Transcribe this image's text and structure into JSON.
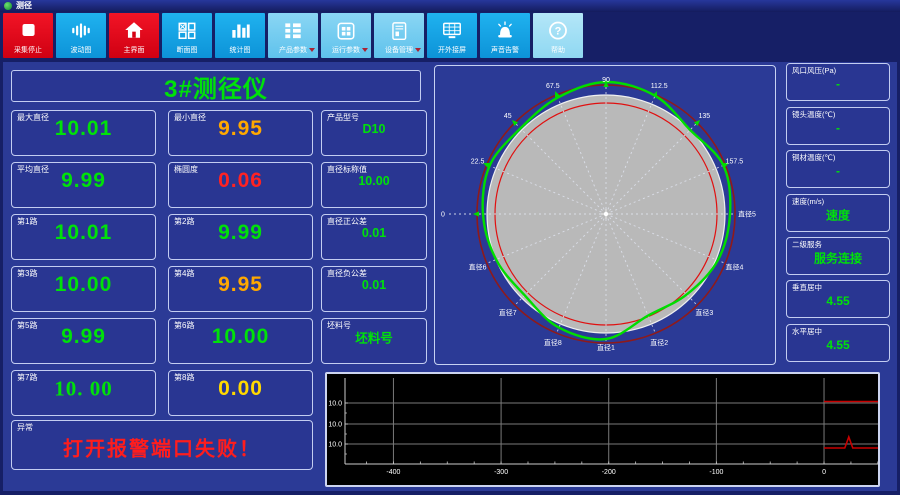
{
  "window": {
    "title": "测径"
  },
  "toolbar": {
    "buttons": [
      {
        "name": "collect-stop",
        "label": "采集停止",
        "icon": "stop-icon",
        "style": "red"
      },
      {
        "name": "wave-chart",
        "label": "波动图",
        "icon": "waveform-icon",
        "style": "blue"
      },
      {
        "name": "main-screen",
        "label": "主界面",
        "icon": "home-icon",
        "style": "red"
      },
      {
        "name": "section-chart",
        "label": "断面图",
        "icon": "sections-icon",
        "style": "blue"
      },
      {
        "name": "stats-chart",
        "label": "统计图",
        "icon": "barchart-icon",
        "style": "blue"
      },
      {
        "name": "product-params",
        "label": "产品参数",
        "icon": "list-icon",
        "style": "light",
        "dropdown": true
      },
      {
        "name": "run-params",
        "label": "运行参数",
        "icon": "grid-icon",
        "style": "light",
        "dropdown": true
      },
      {
        "name": "device-manage",
        "label": "设备管理",
        "icon": "device-icon",
        "style": "light",
        "dropdown": true
      },
      {
        "name": "external-screen",
        "label": "开外接屏",
        "icon": "monitor-icon",
        "style": "blue"
      },
      {
        "name": "sound-alarm",
        "label": "声音告警",
        "icon": "siren-icon",
        "style": "blue"
      },
      {
        "name": "help",
        "label": "帮助",
        "icon": "help-icon",
        "style": "lighter"
      }
    ]
  },
  "left_panel": {
    "title": "3#测径仪",
    "rows": [
      [
        {
          "name": "max-diameter",
          "label": "最大直径",
          "value": "10.01",
          "color": "green"
        },
        {
          "name": "min-diameter",
          "label": "最小直径",
          "value": "9.95",
          "color": "orange"
        },
        {
          "name": "product-model",
          "label": "产品型号",
          "value": "D10",
          "color": "green",
          "small": true
        }
      ],
      [
        {
          "name": "avg-diameter",
          "label": "平均直径",
          "value": "9.99",
          "color": "green"
        },
        {
          "name": "ovality",
          "label": "椭圆度",
          "value": "0.06",
          "color": "red"
        },
        {
          "name": "nominal-diameter",
          "label": "直径标称值",
          "value": "10.00",
          "color": "green",
          "small": true
        }
      ],
      [
        {
          "name": "channel-1",
          "label": "第1路",
          "value": "10.01",
          "color": "green"
        },
        {
          "name": "channel-2",
          "label": "第2路",
          "value": "9.99",
          "color": "green"
        },
        {
          "name": "plus-tolerance",
          "label": "直径正公差",
          "value": "0.01",
          "color": "green",
          "small": true
        }
      ],
      [
        {
          "name": "channel-3",
          "label": "第3路",
          "value": "10.00",
          "color": "green"
        },
        {
          "name": "channel-4",
          "label": "第4路",
          "value": "9.95",
          "color": "orange"
        },
        {
          "name": "minus-tolerance",
          "label": "直径负公差",
          "value": "0.01",
          "color": "green",
          "small": true
        }
      ],
      [
        {
          "name": "channel-5",
          "label": "第5路",
          "value": "9.99",
          "color": "green"
        },
        {
          "name": "channel-6",
          "label": "第6路",
          "value": "10.00",
          "color": "green"
        },
        {
          "name": "billet-no",
          "label": "坯料号",
          "value": "坯料号",
          "color": "green",
          "small": true
        }
      ],
      [
        {
          "name": "channel-7",
          "label": "第7路",
          "value": "10. 00",
          "color": "green",
          "serif": true
        },
        {
          "name": "channel-8",
          "label": "第8路",
          "value": "0.00",
          "color": "yellow"
        }
      ]
    ],
    "alarm": {
      "name": "alarm",
      "label": "异常",
      "value": "打开报警端口失败！",
      "color": "red"
    }
  },
  "right_panel": {
    "items": [
      {
        "name": "air-pressure",
        "label": "风口风压(Pa)",
        "value": "-"
      },
      {
        "name": "lens-temperature",
        "label": "镜头温度(℃)",
        "value": "-"
      },
      {
        "name": "copper-temperature",
        "label": "铜材温度(℃)",
        "value": "-"
      },
      {
        "name": "speed",
        "label": "速度(m/s)",
        "value": "速度"
      },
      {
        "name": "secondary-service",
        "label": "二级服务",
        "value": "服务连接"
      },
      {
        "name": "vertical-center",
        "label": "垂直居中",
        "value": "4.55"
      },
      {
        "name": "horizontal-center",
        "label": "水平居中",
        "value": "4.55"
      }
    ]
  },
  "charts": {
    "profile": {
      "type": "polar-profile",
      "angle_labels": [
        {
          "text": "0",
          "phi": 180
        },
        {
          "text": "22.5",
          "phi": 157.5
        },
        {
          "text": "45",
          "phi": 135
        },
        {
          "text": "67.5",
          "phi": 112.5
        },
        {
          "text": "90",
          "phi": 90
        },
        {
          "text": "112.5",
          "phi": 67.5
        },
        {
          "text": "135",
          "phi": 45
        },
        {
          "text": "157.5",
          "phi": 22.5
        }
      ],
      "diameter_labels": [
        {
          "text": "直径1",
          "phi": 270
        },
        {
          "text": "直径2",
          "phi": 292.5
        },
        {
          "text": "直径3",
          "phi": 315
        },
        {
          "text": "直径4",
          "phi": 337.5
        },
        {
          "text": "直径5",
          "phi": 0
        },
        {
          "text": "直径6",
          "phi": 202.5
        },
        {
          "text": "直径7",
          "phi": 225
        },
        {
          "text": "直径8",
          "phi": 247.5
        }
      ],
      "nominal_radius": 119,
      "outer_tolerance_radius": 129,
      "inner_tolerance_radius": 111,
      "profile_radii": [
        124,
        127,
        119,
        128,
        132,
        126,
        121,
        126,
        123,
        119,
        115,
        123,
        125,
        110,
        114,
        121
      ],
      "colors": {
        "nominal_fill": "#b9b9b9",
        "nominal_edge": "#f0f0f0",
        "outer_circle": "#8f1a1a",
        "inner_circle": "#e01010",
        "profile": "#00dd00",
        "spokes": "#dfe3ee",
        "text": "#ffffff"
      }
    },
    "trend": {
      "type": "line",
      "x_ticks": [
        -400,
        -300,
        -200,
        -100,
        0
      ],
      "x_range": [
        -445,
        52
      ],
      "h_gridlines": [
        {
          "label": "10.0",
          "py": 29
        },
        {
          "label": "10.0",
          "py": 50
        },
        {
          "label": "10.0",
          "py": 70
        }
      ],
      "series": [
        {
          "name": "upper-red",
          "color": "#c80000",
          "py": 27.5,
          "x_from": 0,
          "x_to": 52
        },
        {
          "name": "lower-red",
          "color": "#c80000",
          "py": 74,
          "x_from": 0,
          "x_to": 52,
          "spike": {
            "x": 23,
            "peak_py": 63
          }
        }
      ],
      "plot": {
        "left": 18,
        "right": 553,
        "top": 4,
        "bottom": 90
      },
      "colors": {
        "bg": "#000000",
        "grid": "#7a7a7a",
        "axis": "#cccccc",
        "text": "#ffffff"
      }
    }
  }
}
